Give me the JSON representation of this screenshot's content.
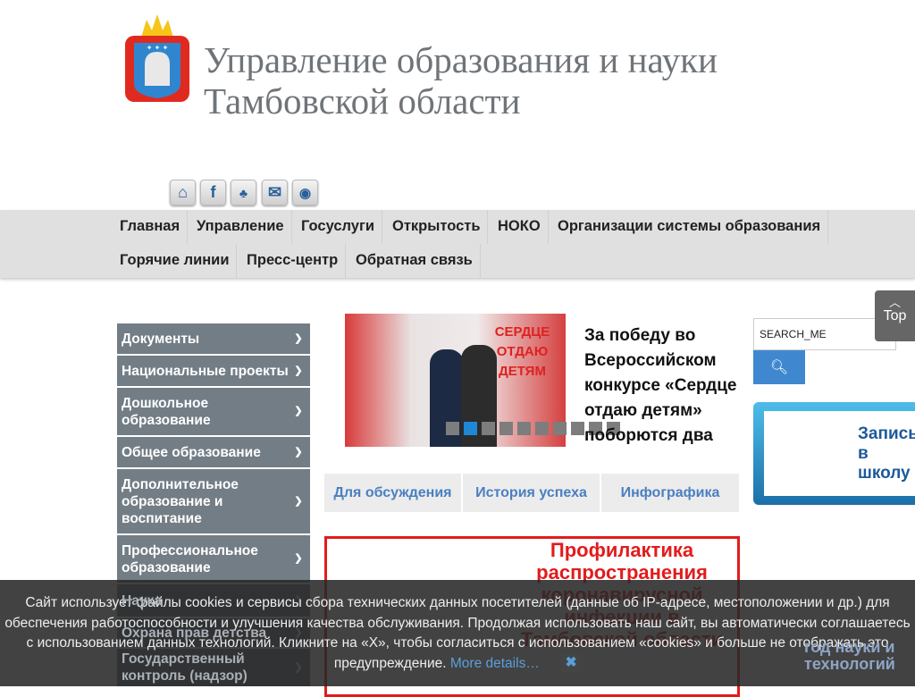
{
  "header": {
    "title": "Управление образования и науки Тамбовской области"
  },
  "social": [
    {
      "icon": "home-icon"
    },
    {
      "icon": "facebook-icon"
    },
    {
      "icon": "sitemap-icon"
    },
    {
      "icon": "mail-icon"
    },
    {
      "icon": "eye-icon"
    }
  ],
  "nav": {
    "row1": [
      "Главная",
      "Управление",
      "Госуслуги",
      "Открытость",
      "НОКО",
      "Организации системы образования"
    ],
    "row2": [
      "Горячие линии",
      "Пресс-центр",
      "Обратная связь"
    ]
  },
  "sidebar": [
    "Документы",
    "Национальные проекты",
    "Дошкольное образование",
    "Общее образование",
    "Дополнительное образование и воспитание",
    "Профессиональное образование",
    "Наука",
    "Охрана прав детства",
    "Государственный контроль (надзор)"
  ],
  "slider": {
    "text": "За победу во Всероссийском конкурсе «Сердце отдаю детям» поборются два",
    "image_text": "СЕРДЦЕ ОТДАЮ ДЕТЯМ",
    "dots": 10,
    "active_dot": 2
  },
  "tabs": [
    "Для обсуждения",
    "История успеха",
    "Инфографика"
  ],
  "covid": {
    "title": "Профилактика распространения коронавирусной инфекции в Тамбовской области"
  },
  "search": {
    "value": "SEARCH_ME"
  },
  "top_button": "Top",
  "school_banner": "Запись в школу",
  "science_logo": "год науки и технологий",
  "cookie": {
    "text": "Сайт использует файлы cookies и сервисы сбора технических данных посетителей (данные об IP-адресе, местоположении и др.) для обеспечения работоспособности и улучшения качества обслуживания. Продолжая использовать наш сайт, вы автоматически соглашаетесь с использованием данных технологий. Кликните на «X», чтобы согласиться с использованием «cookies» и больше не отображать это предупреждение.",
    "more": "More details…",
    "close": "✖"
  },
  "colors": {
    "sidebar": "#737d85",
    "accent": "#3f88d0",
    "covid": "#e31b1b"
  }
}
